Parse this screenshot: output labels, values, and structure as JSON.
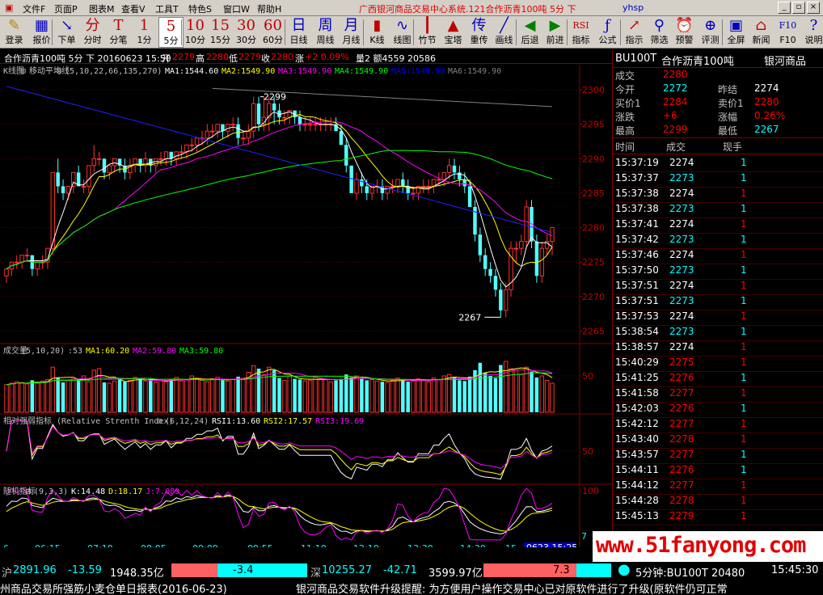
{
  "menu": {
    "items": [
      "文件F",
      "页面P",
      "图表M",
      "查看V",
      "工具T",
      "特色S",
      "窗口W",
      "帮助H"
    ],
    "title_red": "广西银河商品交易中心系统.121合作沥青100吨 5分 下",
    "title_blue": "yhsp",
    "win_buttons": [
      "_",
      "▫",
      "×"
    ]
  },
  "toolbar": [
    {
      "icon": "✎",
      "label": "登录",
      "color": "#c08000"
    },
    {
      "icon": "▦",
      "label": "报价",
      "color": "#0000c0"
    },
    {
      "icon": "↘",
      "label": "下单",
      "color": "#0000c0"
    },
    {
      "icon": "分",
      "label": "分时",
      "color": "#c00000"
    },
    {
      "icon": "T",
      "label": "分笔",
      "color": "#c00000"
    },
    {
      "icon": "1",
      "label": "1分",
      "color": "#c00000"
    },
    {
      "icon": "5",
      "label": "5分",
      "color": "#c00000"
    },
    {
      "icon": "10",
      "label": "10分",
      "color": "#c00000"
    },
    {
      "icon": "15",
      "label": "15分",
      "color": "#c00000"
    },
    {
      "icon": "30",
      "label": "30分",
      "color": "#c00000"
    },
    {
      "icon": "60",
      "label": "60分",
      "color": "#c00000"
    },
    {
      "icon": "日",
      "label": "日线",
      "color": "#0000c0"
    },
    {
      "icon": "周",
      "label": "周线",
      "color": "#0000c0"
    },
    {
      "icon": "月",
      "label": "月线",
      "color": "#0000c0"
    },
    {
      "icon": "▮",
      "label": "K线",
      "color": "#c00000"
    },
    {
      "icon": "∿",
      "label": "线图",
      "color": "#0000c0"
    },
    {
      "icon": "┃",
      "label": "竹节",
      "color": "#c00000"
    },
    {
      "icon": "▲",
      "label": "宝塔",
      "color": "#c00000"
    },
    {
      "icon": "传",
      "label": "重传",
      "color": "#0000c0"
    },
    {
      "icon": "╱",
      "label": "画线",
      "color": "#0000c0"
    },
    {
      "icon": "◀",
      "label": "后退",
      "color": "#008000"
    },
    {
      "icon": "▶",
      "label": "前进",
      "color": "#008000"
    },
    {
      "icon": "RSI",
      "label": "指标",
      "color": "#c00000"
    },
    {
      "icon": "ƒ",
      "label": "公式",
      "color": "#0000c0"
    },
    {
      "icon": "↗",
      "label": "指示",
      "color": "#c00000"
    },
    {
      "icon": "⚲",
      "label": "筛选",
      "color": "#0000c0"
    },
    {
      "icon": "⏰",
      "label": "预警",
      "color": "#c08000"
    },
    {
      "icon": "⊕",
      "label": "评测",
      "color": "#0000c0"
    },
    {
      "icon": "▣",
      "label": "全屏",
      "color": "#0000c0"
    },
    {
      "icon": "⌂",
      "label": "新闻",
      "color": "#c00000"
    },
    {
      "icon": "F10",
      "label": "F10",
      "color": "#0000c0"
    },
    {
      "icon": "?",
      "label": "说明",
      "color": "#0000c0"
    }
  ],
  "infobar": {
    "name": "合作沥青100吨 5分 下 20160623 15:50",
    "open_l": "开",
    "open_v": "2279",
    "high_l": "高",
    "high_v": "2280",
    "low_l": "低",
    "low_v": "2279",
    "close_l": "收",
    "close_v": "2280",
    "chg_l": "涨",
    "chg_v": "+2 0.09%",
    "vol": "量2 额4559 20586"
  },
  "main_panel": {
    "title": "K线图",
    "indicator": "移动平均线",
    "params": "(5,10,22,66,135,270)",
    "ma": [
      {
        "label": "MA1:1544.60",
        "color": "#ffffff"
      },
      {
        "label": "MA2:1549.90",
        "color": "#ffff00"
      },
      {
        "label": "MA3:1549.90",
        "color": "#ff00ff"
      },
      {
        "label": "MA4:1549.90",
        "color": "#00ff00"
      },
      {
        "label": "MA5:1549.90",
        "color": "#0000ff"
      },
      {
        "label": "MA6:1549.90",
        "color": "#808080"
      }
    ],
    "yticks": [
      "2300",
      "2295",
      "2290",
      "2285",
      "2280",
      "2275",
      "2270",
      "2265"
    ],
    "high_mark": "2299",
    "low_mark": "2267"
  },
  "vol_panel": {
    "title": "成交量",
    "params": "(5,10,20)",
    "value": ":53",
    "ma": [
      {
        "label": "MA1:60.20",
        "color": "#ffff00"
      },
      {
        "label": "MA2:59.80",
        "color": "#ff00ff"
      },
      {
        "label": "MA3:59.80",
        "color": "#00ff00"
      }
    ],
    "ytick": "50"
  },
  "rsi_panel": {
    "title": "相对强弱指标 (Relative Strenth Index)",
    "params": "(6,12,24)",
    "vals": [
      {
        "label": "RSI1:13.60",
        "color": "#ffffff"
      },
      {
        "label": "RSI2:17.57",
        "color": "#ffff00"
      },
      {
        "label": "RSI3:19.69",
        "color": "#ff00ff"
      }
    ],
    "ytick": "50"
  },
  "kdj_panel": {
    "title": "随机指标",
    "params": "(9,3,3)",
    "vals": [
      {
        "label": "K:14.48",
        "color": "#ffffff"
      },
      {
        "label": "D:18.17",
        "color": "#ffff00"
      },
      {
        "label": "J:7.089",
        "color": "#ff00ff"
      }
    ],
    "ytick": "100",
    "ytick2": "7"
  },
  "xaxis": [
    "6",
    "06:15",
    "07:10",
    "08:05",
    "09:00",
    "09:55",
    "11:10",
    "12:10",
    "13:30",
    "14:30",
    "15"
  ],
  "cursor_time": "0623 15:25",
  "right_panel": {
    "code": "BU100T",
    "name": "合作沥青100吨",
    "exchange": "银河商品",
    "quotes": [
      {
        "l1": "成交",
        "v1": "2280",
        "c1": "#ff0000",
        "l2": "",
        "v2": "",
        "c2": "#ffffff"
      },
      {
        "l1": "今开",
        "v1": "2272",
        "c1": "#00ffff",
        "l2": "昨结",
        "v2": "2274",
        "c2": "#ffffff"
      },
      {
        "l1": "买价1",
        "v1": "2284",
        "c1": "#ff0000",
        "l2": "卖价1",
        "v2": "2280",
        "c2": "#ff0000"
      },
      {
        "l1": "涨跌",
        "v1": "+6",
        "c1": "#ff0000",
        "l2": "涨幅",
        "v2": "0.26%",
        "c2": "#ff0000"
      },
      {
        "l1": "最高",
        "v1": "2299",
        "c1": "#ff0000",
        "l2": "最低",
        "v2": "2267",
        "c2": "#00ffff"
      }
    ],
    "tick_headers": [
      "时间",
      "成交",
      "现手"
    ],
    "ticks": [
      {
        "t": "15:37:19",
        "p": "2274",
        "v": "1",
        "pc": "#ffffff",
        "vc": "#00ffff"
      },
      {
        "t": "15:37:37",
        "p": "2273",
        "v": "1",
        "pc": "#00ffff",
        "vc": "#00ffff"
      },
      {
        "t": "15:37:38",
        "p": "2274",
        "v": "1",
        "pc": "#ffffff",
        "vc": "#ff0000"
      },
      {
        "t": "15:37:38",
        "p": "2273",
        "v": "1",
        "pc": "#00ffff",
        "vc": "#00ffff"
      },
      {
        "t": "15:37:41",
        "p": "2274",
        "v": "1",
        "pc": "#ffffff",
        "vc": "#ff0000"
      },
      {
        "t": "15:37:42",
        "p": "2273",
        "v": "1",
        "pc": "#00ffff",
        "vc": "#00ffff"
      },
      {
        "t": "15:37:46",
        "p": "2274",
        "v": "1",
        "pc": "#ffffff",
        "vc": "#ff0000"
      },
      {
        "t": "15:37:50",
        "p": "2273",
        "v": "1",
        "pc": "#00ffff",
        "vc": "#00ffff"
      },
      {
        "t": "15:37:51",
        "p": "2274",
        "v": "1",
        "pc": "#ffffff",
        "vc": "#ff0000"
      },
      {
        "t": "15:37:51",
        "p": "2273",
        "v": "1",
        "pc": "#00ffff",
        "vc": "#00ffff"
      },
      {
        "t": "15:37:53",
        "p": "2274",
        "v": "1",
        "pc": "#ffffff",
        "vc": "#ff0000"
      },
      {
        "t": "15:38:54",
        "p": "2273",
        "v": "1",
        "pc": "#00ffff",
        "vc": "#00ffff"
      },
      {
        "t": "15:38:57",
        "p": "2274",
        "v": "1",
        "pc": "#ffffff",
        "vc": "#ff0000"
      },
      {
        "t": "15:40:29",
        "p": "2275",
        "v": "1",
        "pc": "#ff0000",
        "vc": "#ff0000"
      },
      {
        "t": "15:41:25",
        "p": "2276",
        "v": "1",
        "pc": "#ff0000",
        "vc": "#00ffff"
      },
      {
        "t": "15:41:58",
        "p": "2277",
        "v": "1",
        "pc": "#ff0000",
        "vc": "#ff0000"
      },
      {
        "t": "15:42:03",
        "p": "2276",
        "v": "1",
        "pc": "#ff0000",
        "vc": "#00ffff"
      },
      {
        "t": "15:42:12",
        "p": "2277",
        "v": "1",
        "pc": "#ff0000",
        "vc": "#ff0000"
      },
      {
        "t": "15:43:40",
        "p": "2278",
        "v": "1",
        "pc": "#ff0000",
        "vc": "#ff0000"
      },
      {
        "t": "15:43:57",
        "p": "2277",
        "v": "1",
        "pc": "#ff0000",
        "vc": "#00ffff"
      },
      {
        "t": "15:44:11",
        "p": "2276",
        "v": "1",
        "pc": "#ff0000",
        "vc": "#00ffff"
      },
      {
        "t": "15:44:12",
        "p": "2277",
        "v": "1",
        "pc": "#ff0000",
        "vc": "#ff0000"
      },
      {
        "t": "15:44:28",
        "p": "2278",
        "v": "1",
        "pc": "#ff0000",
        "vc": "#ff0000"
      },
      {
        "t": "15:45:13",
        "p": "2279",
        "v": "1",
        "pc": "#ff0000",
        "vc": "#ff0000"
      }
    ]
  },
  "status": {
    "sh_label": "沪",
    "sh_index": "2891.96",
    "sh_chg": "-13.59",
    "sh_amt": "1948.35亿",
    "sh_bar": "-3.4",
    "sz_label": "深",
    "sz_index": "10255.27",
    "sz_chg": "-42.71",
    "sz_amt": "3599.97亿",
    "sz_bar": "7.3",
    "period_info": "5分钟:BU100T 20480",
    "clock": "15:45:30"
  },
  "ticker": {
    "left": "州商品交易所强筋小麦仓单日报表(2016-06-23)",
    "right": "银河商品交易软件升级提醒: 为方便用户操作交易中心已对原软件进行了升级(原软件仍可正常"
  },
  "watermark": "www.51fanyong.com",
  "chart_data": {
    "type": "candlestick",
    "price_range": [
      2264,
      2302
    ],
    "candles": [
      [
        2273,
        2274,
        2272,
        2274
      ],
      [
        2274,
        2275,
        2273,
        2275
      ],
      [
        2275,
        2276,
        2274,
        2275
      ],
      [
        2275,
        2276,
        2274,
        2276
      ],
      [
        2276,
        2277,
        2275,
        2276
      ],
      [
        2276,
        2276,
        2273,
        2274
      ],
      [
        2274,
        2275,
        2273,
        2275
      ],
      [
        2275,
        2276,
        2274,
        2275
      ],
      [
        2275,
        2277,
        2274,
        2277
      ],
      [
        2277,
        2288,
        2276,
        2288
      ],
      [
        2288,
        2290,
        2285,
        2286
      ],
      [
        2286,
        2287,
        2284,
        2285
      ],
      [
        2285,
        2286,
        2284,
        2286
      ],
      [
        2286,
        2288,
        2285,
        2288
      ],
      [
        2288,
        2289,
        2286,
        2286
      ],
      [
        2286,
        2287,
        2285,
        2286
      ],
      [
        2286,
        2289,
        2285,
        2289
      ],
      [
        2289,
        2292,
        2288,
        2290
      ],
      [
        2290,
        2291,
        2289,
        2290
      ],
      [
        2290,
        2290,
        2287,
        2288
      ],
      [
        2288,
        2289,
        2287,
        2289
      ],
      [
        2289,
        2290,
        2288,
        2290
      ],
      [
        2290,
        2290,
        2288,
        2289
      ],
      [
        2289,
        2290,
        2287,
        2288
      ],
      [
        2288,
        2290,
        2287,
        2289
      ],
      [
        2289,
        2290,
        2288,
        2290
      ],
      [
        2290,
        2290,
        2288,
        2289
      ],
      [
        2289,
        2291,
        2288,
        2290
      ],
      [
        2290,
        2290,
        2288,
        2289
      ],
      [
        2289,
        2290,
        2288,
        2290
      ],
      [
        2290,
        2291,
        2289,
        2290
      ],
      [
        2290,
        2291,
        2289,
        2291
      ],
      [
        2291,
        2291,
        2289,
        2290
      ],
      [
        2290,
        2291,
        2289,
        2291
      ],
      [
        2291,
        2292,
        2290,
        2291
      ],
      [
        2291,
        2292,
        2290,
        2292
      ],
      [
        2292,
        2293,
        2291,
        2292
      ],
      [
        2292,
        2293,
        2291,
        2293
      ],
      [
        2293,
        2294,
        2292,
        2293
      ],
      [
        2293,
        2295,
        2292,
        2294
      ],
      [
        2294,
        2295,
        2293,
        2294
      ],
      [
        2294,
        2295,
        2293,
        2295
      ],
      [
        2295,
        2295,
        2293,
        2294
      ],
      [
        2294,
        2295,
        2293,
        2295
      ],
      [
        2295,
        2296,
        2294,
        2295
      ],
      [
        2295,
        2296,
        2292,
        2293
      ],
      [
        2293,
        2294,
        2292,
        2293
      ],
      [
        2293,
        2295,
        2292,
        2294
      ],
      [
        2294,
        2299,
        2293,
        2298
      ],
      [
        2298,
        2299,
        2294,
        2295
      ],
      [
        2295,
        2299,
        2294,
        2296
      ],
      [
        2296,
        2299,
        2294,
        2298
      ],
      [
        2298,
        2299,
        2295,
        2297
      ],
      [
        2297,
        2298,
        2295,
        2296
      ],
      [
        2296,
        2297,
        2295,
        2296
      ],
      [
        2296,
        2297,
        2295,
        2297
      ],
      [
        2297,
        2297,
        2295,
        2296
      ],
      [
        2296,
        2297,
        2294,
        2295
      ],
      [
        2295,
        2296,
        2294,
        2295
      ],
      [
        2295,
        2296,
        2294,
        2295
      ],
      [
        2295,
        2296,
        2294,
        2295
      ],
      [
        2295,
        2296,
        2294,
        2295
      ],
      [
        2295,
        2296,
        2294,
        2295
      ],
      [
        2295,
        2296,
        2294,
        2295
      ],
      [
        2295,
        2296,
        2294,
        2294
      ],
      [
        2294,
        2295,
        2292,
        2292
      ],
      [
        2292,
        2293,
        2288,
        2289
      ],
      [
        2289,
        2289,
        2285,
        2285
      ],
      [
        2285,
        2288,
        2284,
        2287
      ],
      [
        2287,
        2288,
        2285,
        2286
      ],
      [
        2286,
        2287,
        2284,
        2285
      ],
      [
        2285,
        2286,
        2284,
        2286
      ],
      [
        2286,
        2287,
        2285,
        2286
      ],
      [
        2286,
        2287,
        2284,
        2285
      ],
      [
        2285,
        2286,
        2284,
        2286
      ],
      [
        2286,
        2287,
        2285,
        2286
      ],
      [
        2286,
        2287,
        2285,
        2287
      ],
      [
        2287,
        2288,
        2285,
        2286
      ],
      [
        2286,
        2287,
        2284,
        2285
      ],
      [
        2285,
        2286,
        2284,
        2285
      ],
      [
        2285,
        2286,
        2284,
        2286
      ],
      [
        2286,
        2287,
        2285,
        2286
      ],
      [
        2286,
        2287,
        2285,
        2286
      ],
      [
        2286,
        2287,
        2285,
        2287
      ],
      [
        2287,
        2288,
        2286,
        2287
      ],
      [
        2287,
        2288,
        2286,
        2288
      ],
      [
        2288,
        2290,
        2287,
        2289
      ],
      [
        2289,
        2290,
        2287,
        2288
      ],
      [
        2288,
        2289,
        2286,
        2287
      ],
      [
        2287,
        2288,
        2285,
        2286
      ],
      [
        2286,
        2287,
        2283,
        2283
      ],
      [
        2283,
        2284,
        2278,
        2279
      ],
      [
        2279,
        2280,
        2275,
        2276
      ],
      [
        2276,
        2277,
        2273,
        2274
      ],
      [
        2274,
        2275,
        2272,
        2273
      ],
      [
        2273,
        2274,
        2270,
        2271
      ],
      [
        2271,
        2272,
        2267,
        2268
      ],
      [
        2268,
        2272,
        2267,
        2271
      ],
      [
        2271,
        2278,
        2270,
        2277
      ],
      [
        2277,
        2278,
        2275,
        2277
      ],
      [
        2277,
        2279,
        2276,
        2278
      ],
      [
        2278,
        2284,
        2277,
        2283
      ],
      [
        2283,
        2284,
        2277,
        2278
      ],
      [
        2278,
        2279,
        2272,
        2273
      ],
      [
        2273,
        2278,
        2272,
        2277
      ],
      [
        2277,
        2279,
        2276,
        2278
      ],
      [
        2278,
        2280,
        2276,
        2280
      ]
    ],
    "volume": [
      38,
      40,
      42,
      41,
      39,
      44,
      40,
      43,
      45,
      62,
      48,
      41,
      44,
      46,
      45,
      50,
      42,
      58,
      60,
      41,
      40,
      43,
      45,
      42,
      44,
      48,
      46,
      43,
      45,
      41,
      44,
      42,
      46,
      48,
      43,
      45,
      50,
      47,
      44,
      42,
      46,
      48,
      44,
      43,
      45,
      49,
      47,
      55,
      64,
      60,
      52,
      62,
      58,
      47,
      44,
      50,
      46,
      45,
      43,
      44,
      48,
      46,
      45,
      42,
      44,
      46,
      52,
      48,
      50,
      46,
      44,
      45,
      43,
      42,
      41,
      44,
      47,
      45,
      42,
      43,
      46,
      44,
      42,
      47,
      45,
      50,
      52,
      48,
      44,
      43,
      49,
      58,
      68,
      54,
      50,
      47,
      65,
      70,
      60,
      58,
      52,
      62,
      56,
      48,
      50,
      44,
      40
    ]
  }
}
